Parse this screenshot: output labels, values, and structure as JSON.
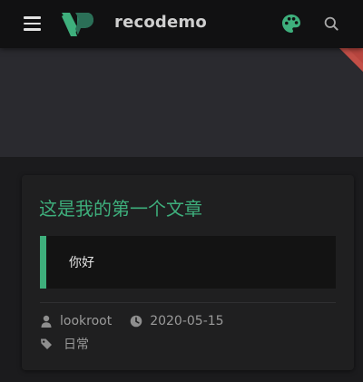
{
  "navbar": {
    "site_name": "recodemo",
    "menu_icon": "hamburger-menu-icon",
    "logo_icon": "reco-logo",
    "theme_icon": "palette-icon",
    "search_icon": "search-icon"
  },
  "colors": {
    "accent": "#3eaf7c",
    "navbar_bg": "#111112",
    "banner_bg": "#2a2a2f",
    "page_bg": "#1b1b1d",
    "card_bg": "#1f1f20",
    "ribbon": "#c0392b"
  },
  "post": {
    "title": "这是我的第一个文章",
    "excerpt": "你好",
    "author": "lookroot",
    "date": "2020-05-15",
    "tag": "日常",
    "author_icon": "user-icon",
    "date_icon": "clock-icon",
    "tag_icon": "tag-icon"
  }
}
